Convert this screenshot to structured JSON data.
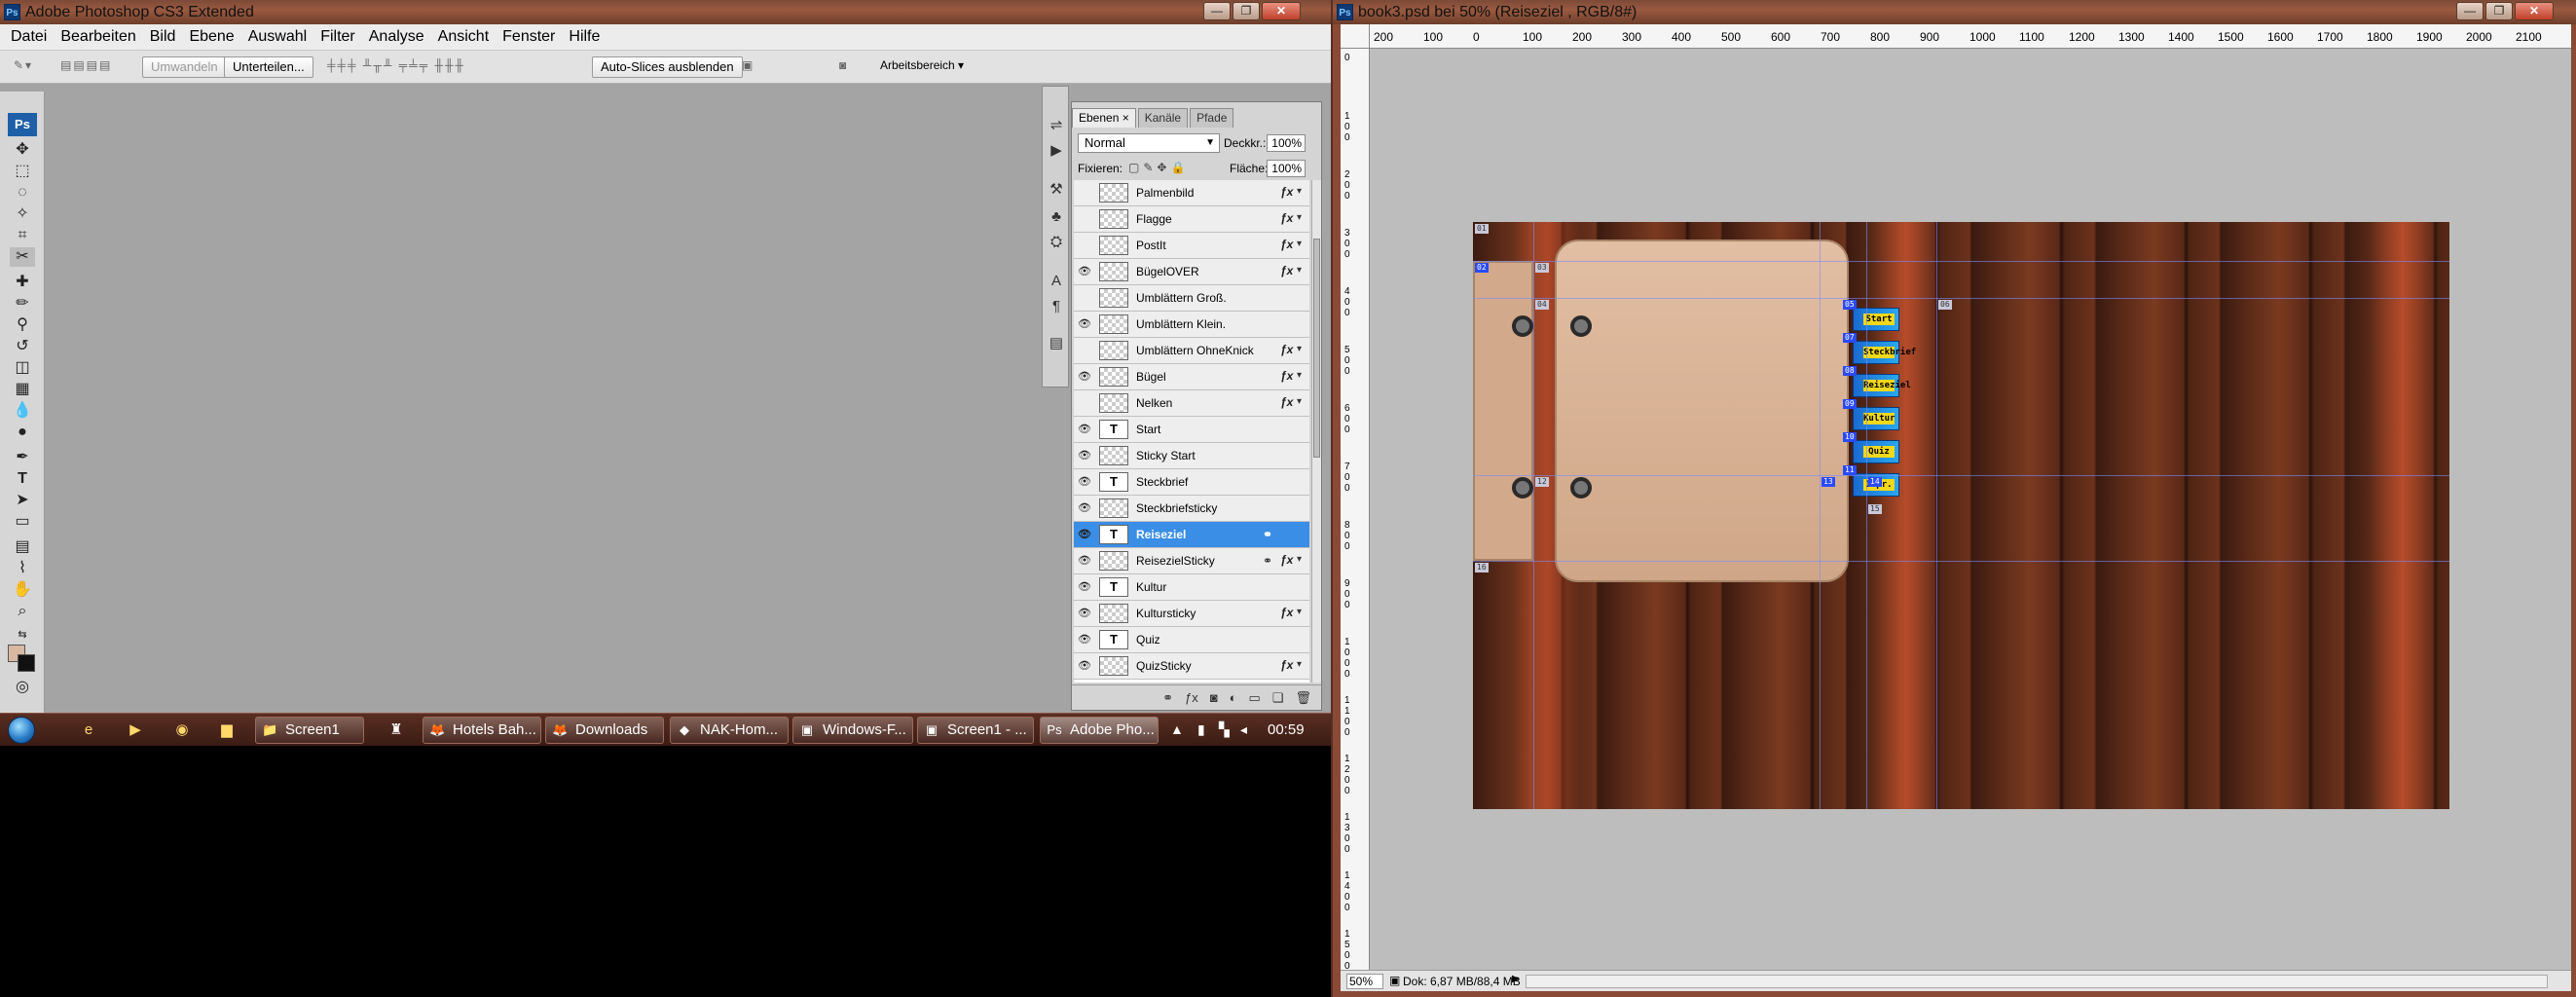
{
  "left_window": {
    "title": "Adobe Photoshop CS3 Extended",
    "app_icon": "Ps",
    "controls": {
      "minimize": "—",
      "restore": "❐",
      "close": "✕"
    },
    "menu": [
      "Datei",
      "Bearbeiten",
      "Bild",
      "Ebene",
      "Auswahl",
      "Filter",
      "Analyse",
      "Ansicht",
      "Fenster",
      "Hilfe"
    ],
    "options_bar": {
      "umwandeln": "Umwandeln",
      "unterteilen": "Unterteilen...",
      "auto_slices": "Auto-Slices ausblenden",
      "workspace": "Arbeitsbereich ▾"
    },
    "toolbox_logo": "Ps"
  },
  "layers_panel": {
    "tabs": [
      "Ebenen ×",
      "Kanäle",
      "Pfade"
    ],
    "blend_mode": "Normal",
    "opacity_label": "Deckkr.:",
    "opacity_value": "100%",
    "lock_label": "Fixieren:",
    "fill_label": "Fläche:",
    "fill_value": "100%",
    "layers": [
      {
        "name": "Palmenbild",
        "visible": false,
        "kind": "pixel",
        "fx": true
      },
      {
        "name": "Flagge",
        "visible": false,
        "kind": "pixel",
        "fx": true
      },
      {
        "name": "PostIt",
        "visible": false,
        "kind": "pixel",
        "fx": true
      },
      {
        "name": "BügelOVER",
        "visible": true,
        "kind": "pixel",
        "fx": true
      },
      {
        "name": "Umblättern Groß.",
        "visible": false,
        "kind": "pixel",
        "fx": false
      },
      {
        "name": "Umblättern Klein.",
        "visible": true,
        "kind": "pixel",
        "fx": false
      },
      {
        "name": "Umblättern OhneKnick",
        "visible": false,
        "kind": "pixel",
        "fx": true
      },
      {
        "name": "Bügel",
        "visible": true,
        "kind": "pixel",
        "fx": true
      },
      {
        "name": "Nelken",
        "visible": false,
        "kind": "pixel",
        "fx": true
      },
      {
        "name": "Start",
        "visible": true,
        "kind": "text",
        "fx": false
      },
      {
        "name": "Sticky Start",
        "visible": true,
        "kind": "pixel",
        "fx": false
      },
      {
        "name": "Steckbrief",
        "visible": true,
        "kind": "text",
        "fx": false
      },
      {
        "name": "Steckbriefsticky",
        "visible": true,
        "kind": "pixel",
        "fx": false
      },
      {
        "name": "Reiseziel",
        "visible": true,
        "kind": "text",
        "fx": false,
        "selected": true,
        "link": true
      },
      {
        "name": "ReisezielSticky",
        "visible": true,
        "kind": "pixel",
        "fx": true,
        "link": true
      },
      {
        "name": "Kultur",
        "visible": true,
        "kind": "text",
        "fx": false
      },
      {
        "name": "Kultursticky",
        "visible": true,
        "kind": "pixel",
        "fx": true
      },
      {
        "name": "Quiz",
        "visible": true,
        "kind": "text",
        "fx": false
      },
      {
        "name": "QuizSticky",
        "visible": true,
        "kind": "pixel",
        "fx": true
      }
    ]
  },
  "taskbar": {
    "tasks": [
      "Screen1",
      "Hotels Bah...",
      "Downloads",
      "NAK-Hom...",
      "Windows-F...",
      "Screen1 - ...",
      "Adobe Pho..."
    ],
    "clock": "00:59"
  },
  "right_window": {
    "title": "book3.psd bei 50% (Reiseziel , RGB/8#)",
    "app_icon": "Ps",
    "ruler_h": [
      "200",
      "100",
      "0",
      "100",
      "200",
      "300",
      "400",
      "500",
      "600",
      "700",
      "800",
      "900",
      "1000",
      "1100",
      "1200",
      "1300",
      "1400",
      "1500",
      "1600",
      "1700",
      "1800",
      "1900",
      "2000",
      "2100"
    ],
    "ruler_v": [
      "0",
      "1\n0\n0",
      "2\n0\n0",
      "3\n0\n0",
      "4\n0\n0",
      "5\n0\n0",
      "6\n0\n0",
      "7\n0\n0",
      "8\n0\n0",
      "9\n0\n0",
      "1\n0\n0\n0",
      "1\n1\n0\n0",
      "1\n2\n0\n0",
      "1\n3\n0\n0",
      "1\n4\n0\n0",
      "1\n5\n0\n0"
    ],
    "tab_labels": [
      "Start",
      "Steckbrief",
      "Reiseziel",
      "Kultur",
      "Quiz",
      "Impr."
    ],
    "slice_badges": [
      "01",
      "02",
      "03",
      "04",
      "05",
      "06",
      "07",
      "08",
      "09",
      "10",
      "11",
      "12",
      "13",
      "14",
      "15",
      "16"
    ],
    "zoom": "50%",
    "doc_info": "Dok: 6,87 MB/88,4 MB"
  }
}
